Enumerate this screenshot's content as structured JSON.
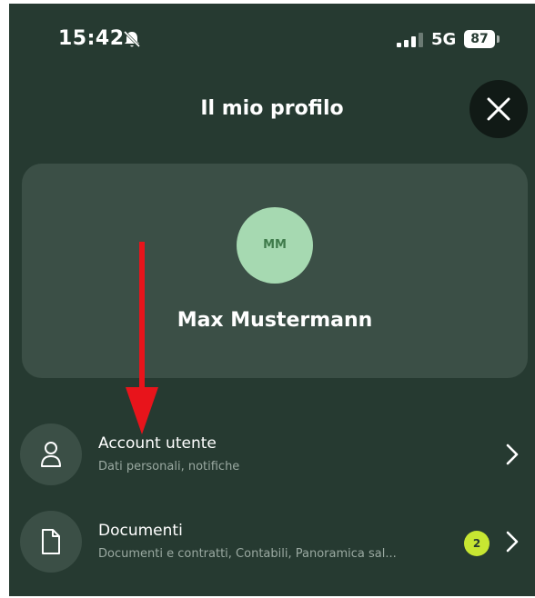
{
  "status_bar": {
    "time": "15:42",
    "network": "5G",
    "battery_percent": "87"
  },
  "header": {
    "title": "Il mio profilo"
  },
  "profile": {
    "initials": "MM",
    "name": "Max Mustermann"
  },
  "menu": {
    "items": [
      {
        "title": "Account utente",
        "subtitle": "Dati personali, notifiche",
        "icon": "user-icon"
      },
      {
        "title": "Documenti",
        "subtitle": "Documenti e contratti, Contabili, Panoramica sal...",
        "icon": "document-icon",
        "badge": "2"
      }
    ]
  },
  "colors": {
    "background": "#263a31",
    "card": "#3b4f46",
    "avatar": "#a6d9b1",
    "badge": "#c7e632",
    "annotation_arrow": "#e8141b"
  }
}
